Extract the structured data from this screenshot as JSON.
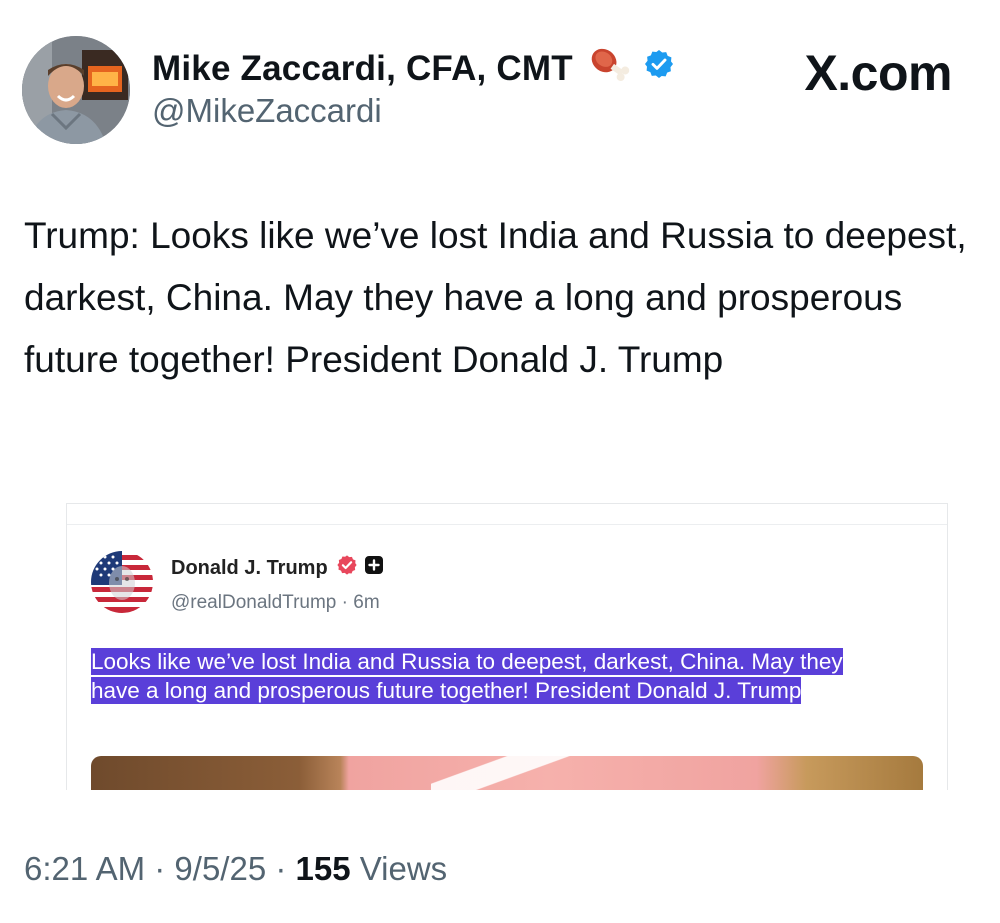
{
  "author": {
    "display_name": "Mike Zaccardi, CFA, CMT",
    "handle": "@MikeZaccardi"
  },
  "brand": "X.com",
  "tweet": {
    "text": "Trump: Looks like we’ve lost India and Russia to deepest, darkest, China. May they have a long and prosperous future together! President Donald J. Trump"
  },
  "embedded_post": {
    "author_name": "Donald J. Trump",
    "handle": "@realDonaldTrump",
    "time_ago": "6m",
    "text": "Looks like we’ve lost India and Russia to deepest, darkest, China. May they have a long and prosperous future together! President Donald J. Trump"
  },
  "meta": {
    "time": "6:21 AM",
    "date": "9/5/25",
    "views_count": "155",
    "views_label": "Views"
  },
  "colors": {
    "verified_blue": "#1d9bf0",
    "highlight_purple": "#5a3fd9",
    "secondary_text": "#536471"
  }
}
